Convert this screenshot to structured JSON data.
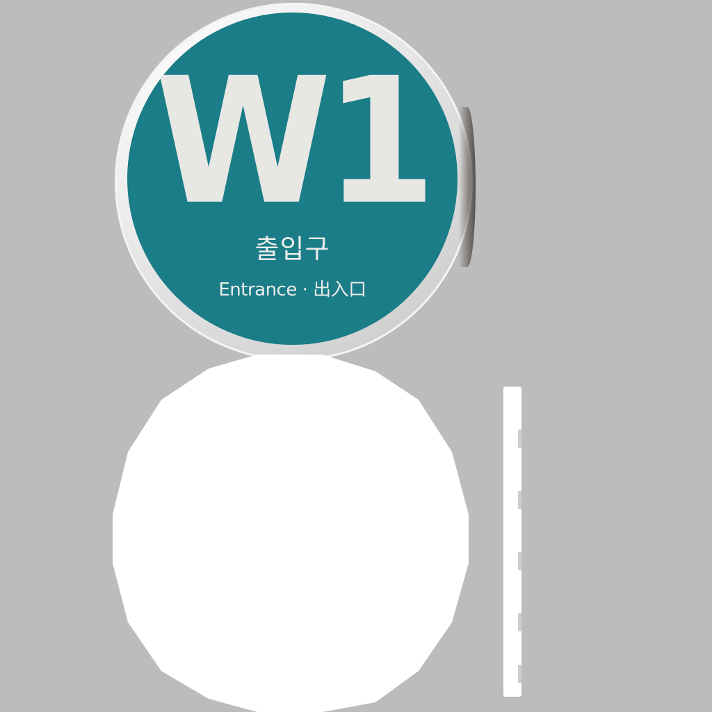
{
  "sign": {
    "title": "W1",
    "korean": "출입구",
    "english": "Entrance · 出入口",
    "face_color": "#1a7d88",
    "text_color": "#e7e7e4"
  },
  "background_color": "#bcbcbc"
}
